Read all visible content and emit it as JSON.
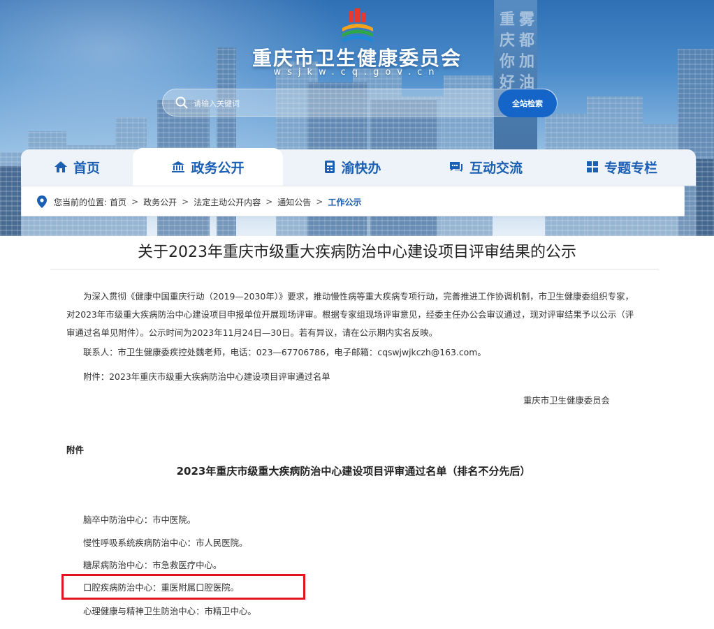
{
  "header": {
    "site_title": "重庆市卫生健康委员会",
    "site_domain": "wsjkw.cq.gov.cn",
    "search": {
      "placeholder": "请输入关键词",
      "button_label": "全站检索"
    },
    "tower_glyphs": [
      "重",
      "庆",
      "你",
      "好",
      "雾",
      "都",
      "加",
      "油"
    ]
  },
  "nav": {
    "items": [
      {
        "label": "首页",
        "icon": "home-icon"
      },
      {
        "label": "政务公开",
        "icon": "government-icon",
        "active": true
      },
      {
        "label": "渝快办",
        "icon": "service-icon"
      },
      {
        "label": "互动交流",
        "icon": "chat-icon"
      },
      {
        "label": "专题专栏",
        "icon": "grid-icon"
      }
    ]
  },
  "breadcrumb": {
    "prefix": "您当前的位置:",
    "items": [
      "首页",
      "政务公开",
      "法定主动公开内容",
      "通知公告",
      "工作公示"
    ],
    "separator": ">"
  },
  "article": {
    "title": "关于2023年重庆市级重大疾病防治中心建设项目评审结果的公示",
    "body": "为深入贯彻《健康中国重庆行动（2019—2030年）》要求，推动慢性病等重大疾病专项行动，完善推进工作协调机制，市卫生健康委组织专家，对2023年市级重大疾病防治中心建设项目申报单位开展现场评审。根据专家组现场评审意见，经委主任办公会审议通过，现对评审结果予以公示（评审通过名单见附件）。公示时间为2023年11月24日—30日。若有异议，请在公示期内实名反映。",
    "contact": "联系人：市卫生健康委疾控处魏老师，电话：023—67706786，电子邮箱：cqswjwjkczh@163.com。",
    "attachment": "附件：2023年重庆市级重大疾病防治中心建设项目评审通过名单",
    "signer": "重庆市卫生健康委员会"
  },
  "annex": {
    "label": "附件",
    "title": "2023年重庆市级重大疾病防治中心建设项目评审通过名单（排名不分先后）",
    "items": [
      "脑卒中防治中心：市中医院。",
      "慢性呼吸系统疾病防治中心：市人民医院。",
      "糖尿病防治中心：市急救医疗中心。",
      "口腔疾病防治中心：重医附属口腔医院。",
      "心理健康与精神卫生防治中心：市精卫中心。"
    ],
    "highlighted_index": 3
  },
  "colors": {
    "brand_blue": "#1a5fb4",
    "button_blue": "#1565c8",
    "highlight_red": "#e0151f"
  }
}
